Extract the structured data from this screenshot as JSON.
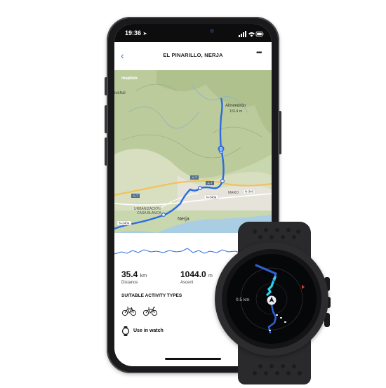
{
  "status_bar": {
    "time": "19:36"
  },
  "header": {
    "title": "EL PINARILLO, NERJA",
    "back_icon": "chevron-left-icon",
    "menu_icon": "more-icon"
  },
  "map": {
    "attribution": "mapbox",
    "places": {
      "almendron": "Almendrón",
      "almendron_elev": "1514 m",
      "frigiliana_fragment": "buchal",
      "urbanization": "URBANIZACIÓN",
      "casa_blanca": "CASA BLANCA",
      "nerja": "Nerja",
      "maro": "MARO"
    },
    "roads": {
      "a7a": "A-7",
      "a7b": "A-7",
      "a7c": "A-7",
      "n340": "N-340",
      "n340a": "N-340a",
      "n340a_left": "N-340a"
    },
    "end_marker": "B",
    "route_color": "#2d6cdf",
    "share_icon": "share-icon"
  },
  "stats": {
    "distance_value": "35.4",
    "distance_unit": "km",
    "distance_label": "Distance",
    "ascent_value": "1044.0",
    "ascent_unit": "m",
    "ascent_label": "Ascent"
  },
  "activities": {
    "heading": "SUITABLE ACTIVITY TYPES",
    "icons": [
      "mountain-bike-icon",
      "road-bike-icon"
    ]
  },
  "watch_toggle": {
    "label": "Use in watch",
    "icon": "watch-icon"
  },
  "watch": {
    "scale_label": "0.5 km",
    "route_color": "#2f62d6",
    "trail_color": "#33d0e6",
    "north_color": "#e03a2a"
  }
}
